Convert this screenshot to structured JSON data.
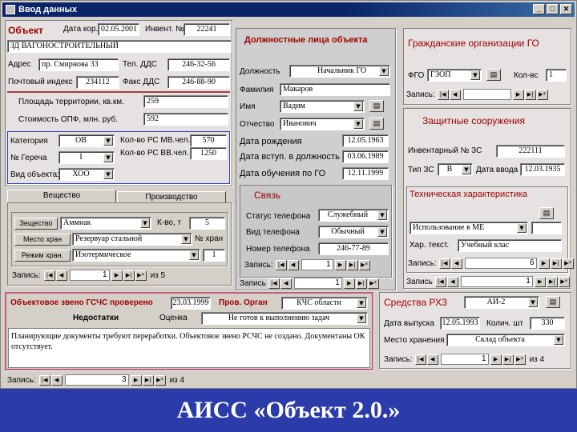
{
  "window": {
    "title": "Ввод данных",
    "min": "_",
    "max": "□",
    "close": "✕"
  },
  "object": {
    "section_title": "Объект",
    "date_label": "Дата кор.",
    "date_value": "02.05.2001",
    "inv_label": "Инвент. №",
    "inv_value": "22241",
    "name_value": "ЗД ВАГОНОСТРОИТЕЛЬНЫЙ",
    "address_label": "Адрес",
    "address_value": "пр. Смирнова 33",
    "phone_label": "Тел. ДДС",
    "phone_value": "246-32-56",
    "postal_label": "Почтовый индекс",
    "postal_value": "234112",
    "fax_label": "Факс ДДС",
    "fax_value": "246-88-90",
    "area_label": "Площадь территории, кв.км.",
    "area_value": "259",
    "cost_label": "Стоимость ОПФ, млн. руб.",
    "cost_value": "592",
    "category_label": "Категория",
    "category_value": "ОВ",
    "group_label": "№ Гереча",
    "group_value": "I",
    "kind_label": "Вид объекта:",
    "kind_value": "ХОО",
    "rschv_label1": "Кол-во РС МВ.чел.",
    "rschv_value1": "570",
    "rschv_label2": "Кол-во РС ВВ.чел.",
    "rschv_value2": "1250"
  },
  "tabs": {
    "substance": "Вещество",
    "production": "Производство"
  },
  "substance": {
    "substance_btn": "Зещество",
    "substance_value": "Аммиак",
    "qty_label": "К-во, т",
    "qty_value": "5",
    "storage_btn": "Место хран",
    "storage_value": "Резервуар стальной",
    "storage_no_label": "№ хран",
    "mode_btn": "Режим хран.",
    "mode_value": "Изотермическое",
    "mode_no": "1",
    "nav_label": "Запись:",
    "nav_value": "1",
    "nav_of": "из 5"
  },
  "official": {
    "title": "Должностные лица объекта",
    "position_label": "Должность",
    "position_value": "Начальник ГО",
    "surname_label": "Фамилия",
    "surname_value": "Макаров",
    "name_label": "Имя",
    "name_value": "Вадим",
    "patronymic_label": "Отчество",
    "patronymic_value": "Иванович",
    "birth_label": "Дата рождения",
    "birth_value": "12.05.1963",
    "entry_label": "Дата вступ. в должность",
    "entry_value": "03.06.1989",
    "training_label": "Дата обучения по ГО",
    "training_value": "12.11.1999",
    "comm_title": "Связь",
    "status_label": "Статус телефона",
    "status_value": "Служебный",
    "type_label": "Вид телефона",
    "type_value": "Обычный",
    "number_label": "Номер телефона",
    "number_value": "246-77-89",
    "nav_inner_label": "Запись:",
    "nav_inner_value": "1",
    "nav_label": "Запись",
    "nav_value": "1"
  },
  "civil": {
    "title": "Гражданские организации ГО",
    "fgo_label": "ФГО",
    "fgo_value": "ГЗОП",
    "qty_label": "Кол-вс",
    "qty_value": "1",
    "nav_label": "Запись:",
    "nav_value": ""
  },
  "shelters": {
    "title": "Защитные сооружения",
    "inv_label": "Инвентарный № ЗС",
    "inv_value": "222111",
    "type_label": "Тип ЗС",
    "type_value": "В",
    "date_label": "Дата ввода",
    "date_value": "12.03.1935",
    "tech_title": "Техническая характеристика",
    "usage_value": "Использование в МЕ",
    "feature_label": "Хар. текст.",
    "feature_value": "Учебный клас",
    "nav_label": "Запись:",
    "nav_value": "6",
    "nav2_label": "Запись",
    "nav2_value": "1"
  },
  "gschs": {
    "title": "Объектовое звено ГСЧС проверено",
    "date_value": "23.03.1999",
    "organ_label": "Пров. Орган",
    "organ_value": "КЧС области",
    "drawbacks_label": "Недостатки",
    "rating_label": "Оценка",
    "rating_value": "Не готов к выполнению задач",
    "memo": "Планирующие документы требуют переработки. Объектовое звено РСЧС не создано. Документаны ОК отсутствует.",
    "nav_label": "Запись:",
    "nav_value": "3",
    "nav_of": "из 4"
  },
  "rhz": {
    "title": "Средства РХЗ",
    "value": "АИ-2",
    "issue_label": "Дата выпуска",
    "issue_value": "12.05.1993",
    "count_label": "Колич. шт",
    "count_value": "330",
    "store_label": "Место хранения",
    "store_value": "Склад объекта",
    "nav_label": "Запись:",
    "nav_value": "1",
    "nav_of": "из 4"
  },
  "main_nav": {
    "label": "Запись:",
    "value": "3",
    "of": "из 4"
  },
  "nav_glyphs": {
    "first": "|◀",
    "prev": "◀",
    "next": "▶",
    "last": "▶|",
    "new": "▶*",
    "drop": "▼",
    "book": "▤",
    "binoc": "⧉"
  },
  "caption": "АИСС «Объект 2.0.»"
}
